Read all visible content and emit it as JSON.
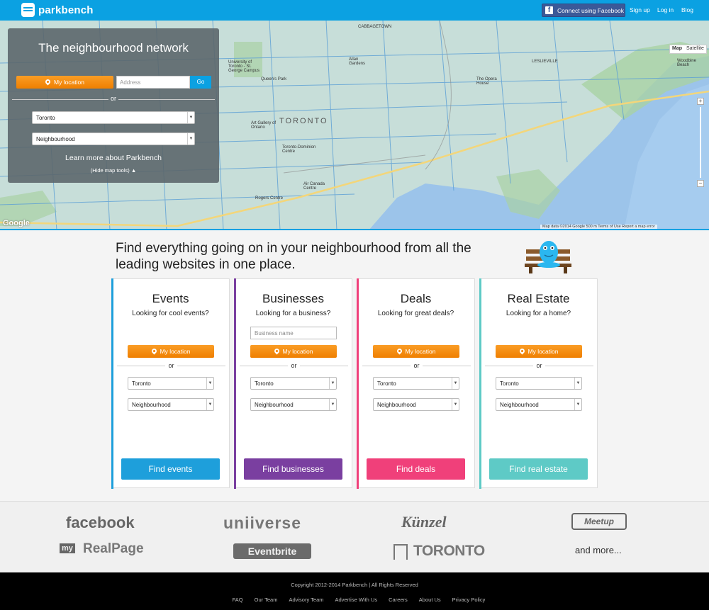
{
  "header": {
    "logo_text": "parkbench",
    "facebook_icon": "f",
    "facebook_label": "Connect using Facebook",
    "signup": "Sign up",
    "login": "Log in",
    "blog": "Blog"
  },
  "map": {
    "type_map": "Map",
    "type_satellite": "Satellite",
    "zoom_in": "+",
    "zoom_out": "−",
    "google": "Google",
    "footer": "Map data ©2014 Google   500 m   Terms of Use   Report a map error",
    "labels": {
      "toronto": "TORONTO",
      "queens_park": "Queen's Park",
      "university_college": "University of Toronto - St. George Campus",
      "art_gallery": "Art Gallery of Ontario",
      "toronto_dominion": "Toronto-Dominion Centre",
      "cn_tower": "Air Canada Centre",
      "rogers": "Rogers Centre",
      "opera_house": "The Opera House",
      "cabbagetown": "CABBAGETOWN",
      "leslieville": "LESLIEVILLE",
      "woodbine": "Woodbine Beach",
      "allan_gardens": "Allan Gardens"
    }
  },
  "panel": {
    "title": "The neighbourhood network",
    "my_location": "My location",
    "address_placeholder": "Address",
    "go": "Go",
    "or": "or",
    "city": "Toronto",
    "neighbourhood": "Neighbourhood",
    "learn_more": "Learn more about Parkbench",
    "hide_tools": "(Hide map tools) ▲"
  },
  "tagline": "Find everything going on in your neighbourhood from all the leading websites in one place.",
  "cards": [
    {
      "title": "Events",
      "subtitle": "Looking for cool events?",
      "my_location": "My location",
      "or": "or",
      "city": "Toronto",
      "neighbourhood": "Neighbourhood",
      "button": "Find events"
    },
    {
      "title": "Businesses",
      "subtitle": "Looking for a business?",
      "placeholder": "Business name",
      "my_location": "My location",
      "or": "or",
      "city": "Toronto",
      "neighbourhood": "Neighbourhood",
      "button": "Find businesses"
    },
    {
      "title": "Deals",
      "subtitle": "Looking for great deals?",
      "my_location": "My location",
      "or": "or",
      "city": "Toronto",
      "neighbourhood": "Neighbourhood",
      "button": "Find deals"
    },
    {
      "title": "Real Estate",
      "subtitle": "Looking for a home?",
      "my_location": "My location",
      "or": "or",
      "city": "Toronto",
      "neighbourhood": "Neighbourhood",
      "button": "Find real estate"
    }
  ],
  "colors": {
    "brand": "#0ba1e2",
    "orange": "#ef7f00",
    "events": "#1e9fdb",
    "businesses": "#7a3fa0",
    "deals": "#f0407a",
    "real_estate": "#5ecac6"
  },
  "partners": {
    "facebook": "facebook",
    "uniiverse": "uniiverse",
    "kunzel": "Künzel",
    "meetup": "Meetup",
    "realpage": "RealPage",
    "myprefix": "my",
    "eventbrite": "Eventbrite",
    "toronto": "TORONTO",
    "more": "and more..."
  },
  "footer": {
    "copyright": "Copyright 2012-2014 Parkbench | All Rights Reserved",
    "links": [
      "FAQ",
      "Our Team",
      "Advisory Team",
      "Advertise With Us",
      "Careers",
      "About Us",
      "Privacy Policy"
    ]
  }
}
